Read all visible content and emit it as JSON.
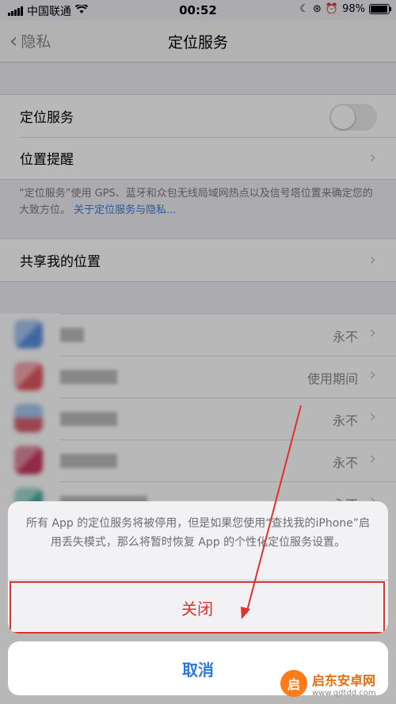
{
  "status_bar": {
    "carrier": "中国联通",
    "time": "00:52",
    "battery": "98%"
  },
  "nav": {
    "back_label": "隐私",
    "title": "定位服务"
  },
  "settings": {
    "location_services_label": "定位服务",
    "location_services_on": false,
    "location_alerts_label": "位置提醒",
    "note_text": "“定位服务”使用 GPS、蓝牙和众包无线局域网热点以及信号塔位置来确定您的大致方位。",
    "note_link": "关于定位服务与隐私...",
    "share_location_label": "共享我的位置"
  },
  "apps": [
    {
      "value": "永不",
      "icon_color": "#5b8fe0"
    },
    {
      "value": "使用期间",
      "icon_color": "#e05560"
    },
    {
      "value": "永不",
      "icon_color": "#d86070"
    },
    {
      "value": "永不",
      "icon_color": "#c83a60"
    },
    {
      "value": "永不",
      "icon_color": "#4aa6a0"
    }
  ],
  "sheet": {
    "message": "所有 App 的定位服务将被停用，但是如果您使用“查找我的iPhone”启用丢失模式，那么将暂时恢复 App 的个性化定位服务设置。",
    "close_label": "关闭",
    "cancel_label": "取消"
  },
  "watermark": {
    "name": "启东安卓网",
    "url": "www.qdtdd.com"
  },
  "colors": {
    "destructive": "#e0312e",
    "accent": "#2b78e4"
  }
}
